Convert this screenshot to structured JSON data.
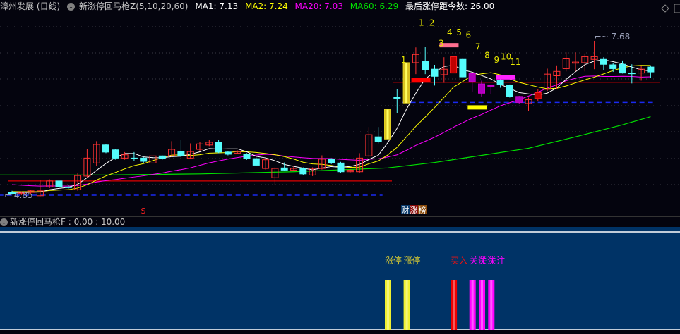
{
  "header": {
    "stock": "漳州发展 (日线)",
    "indicator": "新涨停回马枪Z(5,10,20,60)",
    "ma1": "MA1: 7.13",
    "ma2": "MA2: 7.24",
    "ma20": "MA20: 7.03",
    "ma60": "MA60: 6.29",
    "last_limit": "最后涨停距今数: 26.00"
  },
  "sub": {
    "title": "新涨停回马枪F : 0.00 : 10.00",
    "labels": {
      "limit1": "涨停",
      "limit2": "涨停",
      "buy": "买入",
      "watch": "关注"
    }
  },
  "colors": {
    "up": "#ff3232",
    "down": "#54fcfc",
    "ma1": "#ffffff",
    "ma2": "#ffff00",
    "ma20": "#ff00ff",
    "ma60": "#00e000",
    "bg": "#04040e",
    "sub_bg": "#003366"
  },
  "chart_data": {
    "type": "candlestick",
    "title": "漳州发展 (日线)",
    "price_low_label": "4.85",
    "price_high_label": "7.68",
    "ylim": [
      4.85,
      7.68
    ],
    "candles": [
      [
        4.9,
        4.93,
        4.86,
        4.88,
        "down"
      ],
      [
        4.88,
        4.92,
        4.85,
        4.9,
        "up"
      ],
      [
        4.9,
        4.95,
        4.87,
        4.93,
        "up"
      ],
      [
        4.84,
        5.13,
        4.83,
        4.93,
        "up"
      ],
      [
        5.0,
        5.14,
        4.98,
        5.11,
        "up"
      ],
      [
        5.11,
        5.13,
        4.97,
        5.0,
        "down"
      ],
      [
        5.0,
        5.04,
        4.97,
        5.0,
        "down"
      ],
      [
        4.95,
        5.26,
        4.93,
        5.21,
        "up"
      ],
      [
        5.2,
        5.69,
        5.18,
        5.53,
        "up"
      ],
      [
        5.44,
        5.84,
        5.38,
        5.78,
        "up"
      ],
      [
        5.77,
        5.79,
        5.62,
        5.64,
        "down"
      ],
      [
        5.68,
        5.7,
        5.5,
        5.53,
        "down"
      ],
      [
        5.53,
        5.64,
        5.5,
        5.59,
        "up"
      ],
      [
        5.53,
        5.64,
        5.47,
        5.53,
        "down"
      ],
      [
        5.53,
        5.55,
        5.44,
        5.47,
        "down"
      ],
      [
        5.44,
        5.6,
        5.4,
        5.57,
        "up"
      ],
      [
        5.57,
        5.58,
        5.5,
        5.52,
        "down"
      ],
      [
        5.57,
        5.84,
        5.55,
        5.69,
        "up"
      ],
      [
        5.65,
        5.86,
        5.55,
        5.57,
        "down"
      ],
      [
        5.53,
        5.8,
        5.52,
        5.65,
        "up"
      ],
      [
        5.69,
        5.82,
        5.66,
        5.79,
        "up"
      ],
      [
        5.77,
        5.86,
        5.75,
        5.82,
        "up"
      ],
      [
        5.82,
        5.86,
        5.62,
        5.64,
        "down"
      ],
      [
        5.64,
        5.66,
        5.58,
        5.6,
        "down"
      ],
      [
        5.62,
        5.67,
        5.6,
        5.65,
        "up"
      ],
      [
        5.6,
        5.62,
        5.5,
        5.52,
        "down"
      ],
      [
        5.52,
        5.54,
        5.38,
        5.4,
        "down"
      ],
      [
        5.34,
        5.52,
        5.32,
        5.5,
        "up"
      ],
      [
        5.17,
        5.36,
        5.04,
        5.34,
        "up"
      ],
      [
        5.35,
        5.45,
        5.29,
        5.31,
        "down"
      ],
      [
        5.31,
        5.38,
        5.29,
        5.34,
        "up"
      ],
      [
        5.34,
        5.36,
        5.22,
        5.24,
        "down"
      ],
      [
        5.22,
        5.36,
        5.2,
        5.34,
        "up"
      ],
      [
        5.34,
        5.58,
        5.32,
        5.51,
        "up"
      ],
      [
        5.51,
        5.53,
        5.42,
        5.44,
        "down"
      ],
      [
        5.44,
        5.46,
        5.26,
        5.28,
        "down"
      ],
      [
        5.28,
        5.33,
        5.26,
        5.31,
        "up"
      ],
      [
        5.28,
        5.62,
        5.26,
        5.53,
        "up"
      ],
      [
        5.57,
        6.1,
        5.55,
        5.96,
        "up"
      ],
      [
        5.92,
        6.1,
        5.8,
        5.83,
        "down"
      ],
      [
        5.88,
        6.42,
        5.88,
        6.42,
        "limit"
      ],
      [
        6.64,
        6.79,
        6.36,
        6.64,
        "down"
      ],
      [
        6.54,
        7.28,
        6.54,
        7.28,
        "limit"
      ],
      [
        7.28,
        7.56,
        7.07,
        7.43,
        "up"
      ],
      [
        7.31,
        7.57,
        7.07,
        7.15,
        "down"
      ],
      [
        7.16,
        7.24,
        6.86,
        7.03,
        "down"
      ],
      [
        7.06,
        7.38,
        6.91,
        7.16,
        "up"
      ],
      [
        7.09,
        7.39,
        7.09,
        7.39,
        "solid"
      ],
      [
        7.34,
        7.36,
        7.0,
        7.02,
        "down"
      ],
      [
        7.08,
        7.1,
        6.75,
        6.93,
        "mag"
      ],
      [
        6.89,
        6.95,
        6.66,
        6.72,
        "mag"
      ],
      [
        6.86,
        6.87,
        6.7,
        6.85,
        "mag"
      ],
      [
        6.95,
        7.0,
        6.82,
        6.88,
        "down"
      ],
      [
        6.86,
        6.88,
        6.64,
        6.66,
        "down"
      ],
      [
        6.66,
        6.67,
        6.52,
        6.55,
        "mag"
      ],
      [
        6.53,
        6.64,
        6.4,
        6.6,
        "up"
      ],
      [
        6.62,
        6.79,
        6.58,
        6.73,
        "solid"
      ],
      [
        6.79,
        7.17,
        6.76,
        7.07,
        "up"
      ],
      [
        7.04,
        7.23,
        6.8,
        7.12,
        "up"
      ],
      [
        7.17,
        7.47,
        7.12,
        7.35,
        "up"
      ],
      [
        7.27,
        7.47,
        7.12,
        7.29,
        "up"
      ],
      [
        7.28,
        7.45,
        7.12,
        7.39,
        "up"
      ],
      [
        7.34,
        7.68,
        7.16,
        7.39,
        "up"
      ],
      [
        7.34,
        7.38,
        7.15,
        7.25,
        "down"
      ],
      [
        7.24,
        7.27,
        7.11,
        7.17,
        "down"
      ],
      [
        7.25,
        7.32,
        7.08,
        7.09,
        "down"
      ],
      [
        7.09,
        7.25,
        6.9,
        7.09,
        "down"
      ],
      [
        7.09,
        7.22,
        6.95,
        7.16,
        "up"
      ],
      [
        7.2,
        7.23,
        7.0,
        7.11,
        "down"
      ]
    ],
    "ma60": [
      [
        0,
        5.22
      ],
      [
        10,
        5.22
      ],
      [
        20,
        5.24
      ],
      [
        30,
        5.28
      ],
      [
        40,
        5.35
      ],
      [
        45,
        5.45
      ],
      [
        50,
        5.58
      ],
      [
        55,
        5.71
      ],
      [
        60,
        5.92
      ],
      [
        65,
        6.14
      ],
      [
        68,
        6.29
      ]
    ],
    "ma20_start": [
      5.0,
      5.0,
      5.01,
      5.02,
      5.03,
      5.05,
      5.07,
      5.1,
      5.13,
      5.17
    ],
    "levels": [
      {
        "from": 0,
        "to": 40,
        "price": 5.11,
        "style": "red"
      },
      {
        "from": 41,
        "to": 68.5,
        "price": 6.92,
        "style": "red"
      },
      {
        "from": -1,
        "to": 39,
        "price": 4.85,
        "style": "blue-dash"
      },
      {
        "from": 42,
        "to": 68,
        "price": 6.55,
        "style": "blue-dash"
      }
    ],
    "markers": [
      {
        "i": 43.5,
        "price": 6.96,
        "color": "#ff0000"
      },
      {
        "i": 46.5,
        "price": 7.6,
        "color": "#ff6f91"
      },
      {
        "i": 52.5,
        "price": 7.01,
        "color": "#ff22ff"
      },
      {
        "i": 49.5,
        "price": 6.46,
        "color": "#ffff00"
      }
    ],
    "step_labels": [
      {
        "t": "1",
        "i": 41.7,
        "price": 7.28
      },
      {
        "t": "1",
        "i": 43.6,
        "price": 7.96
      },
      {
        "t": "2",
        "i": 44.7,
        "price": 7.96
      },
      {
        "t": "3",
        "i": 45.7,
        "price": 7.58
      },
      {
        "t": "4",
        "i": 46.6,
        "price": 7.78
      },
      {
        "t": "5",
        "i": 47.6,
        "price": 7.78
      },
      {
        "t": "6",
        "i": 48.6,
        "price": 7.74
      },
      {
        "t": "7",
        "i": 49.6,
        "price": 7.52
      },
      {
        "t": "8",
        "i": 50.6,
        "price": 7.36
      },
      {
        "t": "9",
        "i": 51.6,
        "price": 7.28
      },
      {
        "t": "10",
        "i": 52.6,
        "price": 7.34
      },
      {
        "t": "11",
        "i": 53.6,
        "price": 7.24
      }
    ],
    "annotations": {
      "s_mark": "S",
      "badge": [
        "财",
        "涨",
        "榜"
      ]
    },
    "signals": [
      {
        "i": 40,
        "type": "limit",
        "color": "#f0f030"
      },
      {
        "i": 42,
        "type": "limit",
        "color": "#f0f030"
      },
      {
        "i": 47,
        "type": "buy",
        "color": "#ee0000"
      },
      {
        "i": 49,
        "type": "watch",
        "color": "#ff00ff"
      },
      {
        "i": 50,
        "type": "watch",
        "color": "#ff00ff"
      },
      {
        "i": 51,
        "type": "watch",
        "color": "#ff00ff"
      }
    ]
  }
}
